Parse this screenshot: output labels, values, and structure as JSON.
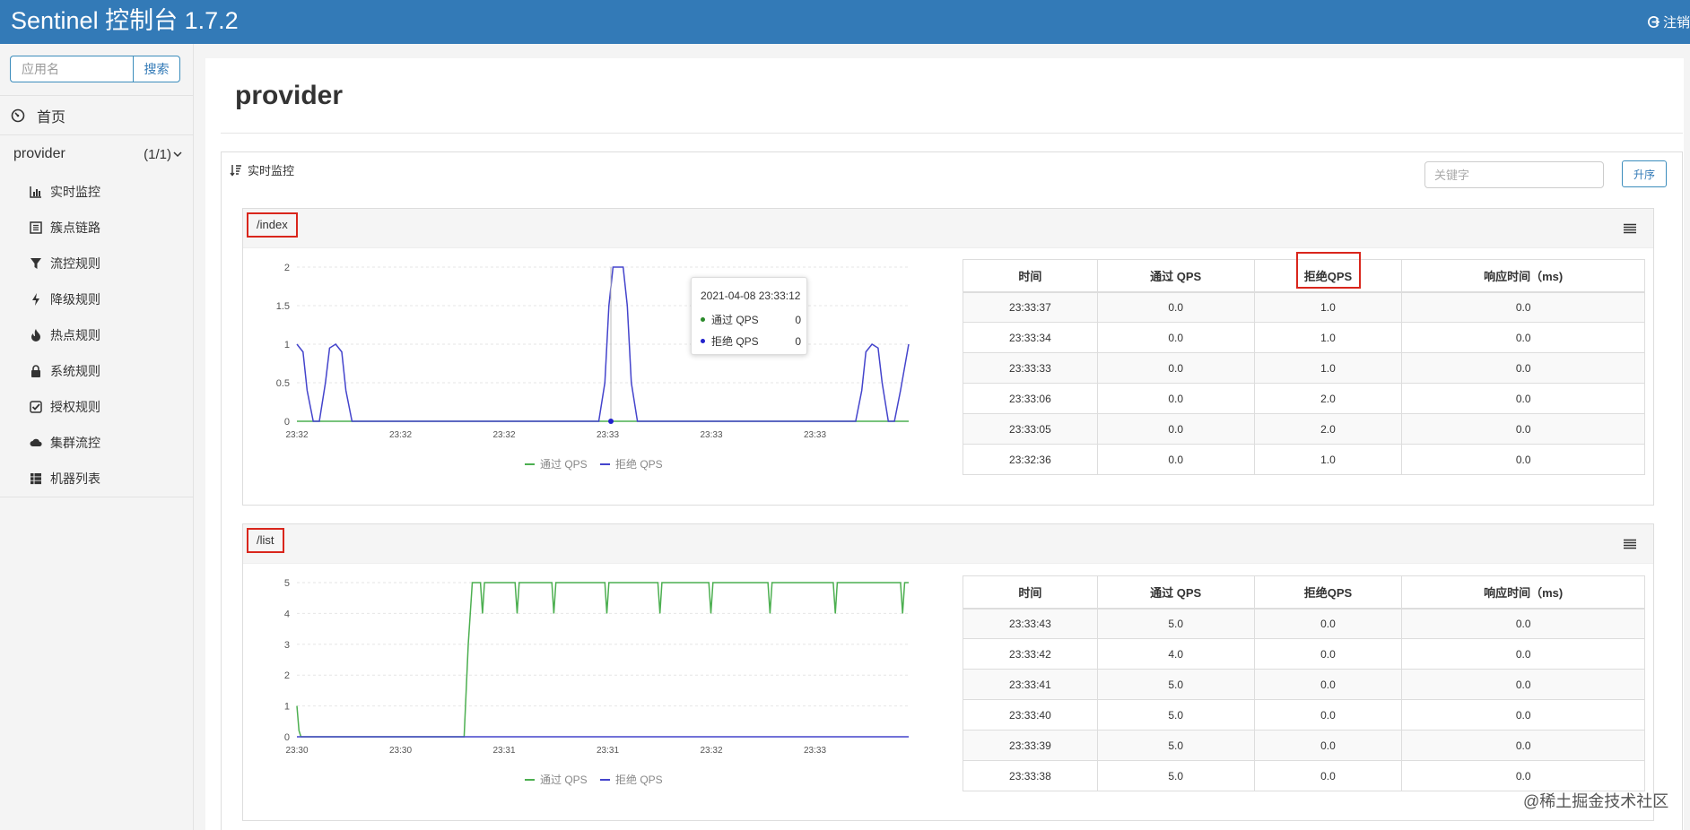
{
  "header": {
    "brand": "Sentinel 控制台 1.7.2",
    "logout_label": "注销"
  },
  "sidebar": {
    "search_placeholder": "应用名",
    "search_button": "搜索",
    "home_label": "首页",
    "app": {
      "name": "provider",
      "count": "(1/1)"
    },
    "items": [
      {
        "label": "实时监控",
        "icon": "bar-chart-icon"
      },
      {
        "label": "簇点链路",
        "icon": "list-alt-icon"
      },
      {
        "label": "流控规则",
        "icon": "filter-icon"
      },
      {
        "label": "降级规则",
        "icon": "flash-icon"
      },
      {
        "label": "热点规则",
        "icon": "fire-icon"
      },
      {
        "label": "系统规则",
        "icon": "lock-icon"
      },
      {
        "label": "授权规则",
        "icon": "check-icon"
      },
      {
        "label": "集群流控",
        "icon": "cloud-icon"
      },
      {
        "label": "机器列表",
        "icon": "th-list-icon"
      }
    ]
  },
  "main": {
    "page_title": "provider",
    "panel_title": "实时监控",
    "keyword_placeholder": "关键字",
    "sort_button": "升序",
    "colors": {
      "pass": "#4caf50",
      "block": "#4444cc",
      "highlight": "#d9261c"
    },
    "table_headers": [
      "时间",
      "通过 QPS",
      "拒绝QPS",
      "响应时间（ms)"
    ],
    "resources": [
      {
        "name": "/index",
        "rows": [
          [
            "23:33:37",
            "0.0",
            "1.0",
            "0.0"
          ],
          [
            "23:33:34",
            "0.0",
            "1.0",
            "0.0"
          ],
          [
            "23:33:33",
            "0.0",
            "1.0",
            "0.0"
          ],
          [
            "23:33:06",
            "0.0",
            "2.0",
            "0.0"
          ],
          [
            "23:33:05",
            "0.0",
            "2.0",
            "0.0"
          ],
          [
            "23:32:36",
            "0.0",
            "1.0",
            "0.0"
          ]
        ],
        "chart_data": {
          "type": "line",
          "yticks": [
            "0",
            "0.5",
            "1",
            "1.5",
            "2"
          ],
          "ylim": [
            0,
            2
          ],
          "xticks": [
            "23:32",
            "23:32",
            "23:32",
            "23:33",
            "23:33",
            "23:33"
          ],
          "xlim": [
            0,
            300
          ],
          "series": [
            {
              "name": "通过 QPS",
              "color": "#4caf50",
              "points": [
                [
                  0,
                  0
                ],
                [
                  300,
                  0
                ]
              ]
            },
            {
              "name": "拒绝 QPS",
              "color": "#4444cc",
              "points": [
                [
                  0,
                  1
                ],
                [
                  3,
                  0.9
                ],
                [
                  5,
                  0.4
                ],
                [
                  8,
                  0
                ],
                [
                  11,
                  0
                ],
                [
                  14,
                  0.5
                ],
                [
                  16,
                  0.95
                ],
                [
                  19,
                  1
                ],
                [
                  22,
                  0.9
                ],
                [
                  24,
                  0.4
                ],
                [
                  27,
                  0
                ],
                [
                  148,
                  0
                ],
                [
                  151,
                  0.5
                ],
                [
                  153,
                  1.5
                ],
                [
                  155,
                  2
                ],
                [
                  160,
                  2
                ],
                [
                  162,
                  1.5
                ],
                [
                  164,
                  0.5
                ],
                [
                  167,
                  0
                ],
                [
                  274,
                  0
                ],
                [
                  277,
                  0.4
                ],
                [
                  279,
                  0.9
                ],
                [
                  282,
                  1
                ],
                [
                  285,
                  0.95
                ],
                [
                  287,
                  0.5
                ],
                [
                  290,
                  0
                ],
                [
                  293,
                  0
                ],
                [
                  296,
                  0.4
                ],
                [
                  300,
                  1
                ]
              ]
            }
          ],
          "legend": [
            "通过 QPS",
            "拒绝 QPS"
          ],
          "tooltip": {
            "time": "2021-04-08 23:33:12",
            "rows": [
              [
                "通过 QPS",
                "0"
              ],
              [
                "拒绝 QPS",
                "0"
              ]
            ]
          }
        }
      },
      {
        "name": "/list",
        "rows": [
          [
            "23:33:43",
            "5.0",
            "0.0",
            "0.0"
          ],
          [
            "23:33:42",
            "4.0",
            "0.0",
            "0.0"
          ],
          [
            "23:33:41",
            "5.0",
            "0.0",
            "0.0"
          ],
          [
            "23:33:40",
            "5.0",
            "0.0",
            "0.0"
          ],
          [
            "23:33:39",
            "5.0",
            "0.0",
            "0.0"
          ],
          [
            "23:33:38",
            "5.0",
            "0.0",
            "0.0"
          ]
        ],
        "chart_data": {
          "type": "line",
          "yticks": [
            "0",
            "1",
            "2",
            "3",
            "4",
            "5"
          ],
          "ylim": [
            0,
            5
          ],
          "xticks": [
            "23:30",
            "23:30",
            "23:31",
            "23:31",
            "23:32",
            "23:33"
          ],
          "xlim": [
            0,
            300
          ],
          "series": [
            {
              "name": "通过 QPS",
              "color": "#4caf50",
              "points": [
                [
                  0,
                  1
                ],
                [
                  1,
                  0.2
                ],
                [
                  2,
                  0
                ],
                [
                  82,
                  0
                ],
                [
                  84,
                  3
                ],
                [
                  86,
                  5
                ],
                [
                  90,
                  5
                ],
                [
                  91,
                  4
                ],
                [
                  92,
                  5
                ],
                [
                  107,
                  5
                ],
                [
                  108,
                  4
                ],
                [
                  109,
                  5
                ],
                [
                  125,
                  5
                ],
                [
                  126,
                  4
                ],
                [
                  127,
                  5
                ],
                [
                  151,
                  5
                ],
                [
                  152,
                  4
                ],
                [
                  153,
                  5
                ],
                [
                  177,
                  5
                ],
                [
                  178,
                  4
                ],
                [
                  179,
                  5
                ],
                [
                  202,
                  5
                ],
                [
                  203,
                  4
                ],
                [
                  204,
                  5
                ],
                [
                  231,
                  5
                ],
                [
                  232,
                  4
                ],
                [
                  233,
                  5
                ],
                [
                  263,
                  5
                ],
                [
                  264,
                  4
                ],
                [
                  265,
                  5
                ],
                [
                  296,
                  5
                ],
                [
                  297,
                  4
                ],
                [
                  298,
                  5
                ],
                [
                  300,
                  5
                ]
              ]
            },
            {
              "name": "拒绝 QPS",
              "color": "#4444cc",
              "points": [
                [
                  0,
                  0
                ],
                [
                  300,
                  0
                ]
              ]
            }
          ],
          "legend": [
            "通过 QPS",
            "拒绝 QPS"
          ]
        }
      }
    ]
  },
  "watermark": "@稀土掘金技术社区"
}
